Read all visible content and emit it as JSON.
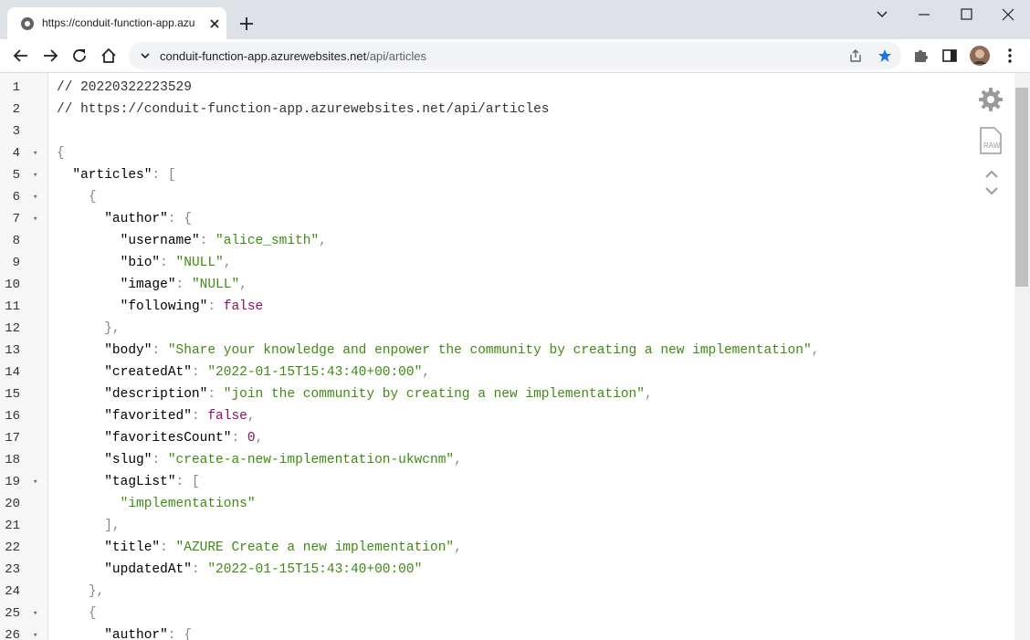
{
  "browser": {
    "tab_title": "https://conduit-function-app.azu",
    "url_host": "conduit-function-app.azurewebsites.net",
    "url_path": "/api/articles",
    "accent": "#1a73e8"
  },
  "editor": {
    "lines": [
      {
        "n": "1",
        "fold": false,
        "html": "<span class=\"c\">// 20220322223529</span>"
      },
      {
        "n": "2",
        "fold": false,
        "html": "<span class=\"c\">// https://conduit-function-app.azurewebsites.net/api/articles</span>"
      },
      {
        "n": "3",
        "fold": false,
        "html": ""
      },
      {
        "n": "4",
        "fold": true,
        "html": "<span class=\"p\">{</span>"
      },
      {
        "n": "5",
        "fold": true,
        "html": "  <span class=\"k\">\"articles\"</span><span class=\"p\">: [</span>"
      },
      {
        "n": "6",
        "fold": true,
        "html": "    <span class=\"p\">{</span>"
      },
      {
        "n": "7",
        "fold": true,
        "html": "      <span class=\"k\">\"author\"</span><span class=\"p\">: {</span>"
      },
      {
        "n": "8",
        "fold": false,
        "html": "        <span class=\"k\">\"username\"</span><span class=\"p\">: </span><span class=\"s\">\"alice_smith\"</span><span class=\"p\">,</span>"
      },
      {
        "n": "9",
        "fold": false,
        "html": "        <span class=\"k\">\"bio\"</span><span class=\"p\">: </span><span class=\"s\">\"NULL\"</span><span class=\"p\">,</span>"
      },
      {
        "n": "10",
        "fold": false,
        "html": "        <span class=\"k\">\"image\"</span><span class=\"p\">: </span><span class=\"s\">\"NULL\"</span><span class=\"p\">,</span>"
      },
      {
        "n": "11",
        "fold": false,
        "html": "        <span class=\"k\">\"following\"</span><span class=\"p\">: </span><span class=\"b\">false</span>"
      },
      {
        "n": "12",
        "fold": false,
        "html": "      <span class=\"p\">},</span>"
      },
      {
        "n": "13",
        "fold": false,
        "html": "      <span class=\"k\">\"body\"</span><span class=\"p\">: </span><span class=\"s\">\"Share your knowledge and enpower the community by creating a new implementation\"</span><span class=\"p\">,</span>"
      },
      {
        "n": "14",
        "fold": false,
        "html": "      <span class=\"k\">\"createdAt\"</span><span class=\"p\">: </span><span class=\"s\">\"2022-01-15T15:43:40+00:00\"</span><span class=\"p\">,</span>"
      },
      {
        "n": "15",
        "fold": false,
        "html": "      <span class=\"k\">\"description\"</span><span class=\"p\">: </span><span class=\"s\">\"join the community by creating a new implementation\"</span><span class=\"p\">,</span>"
      },
      {
        "n": "16",
        "fold": false,
        "html": "      <span class=\"k\">\"favorited\"</span><span class=\"p\">: </span><span class=\"b\">false</span><span class=\"p\">,</span>"
      },
      {
        "n": "17",
        "fold": false,
        "html": "      <span class=\"k\">\"favoritesCount\"</span><span class=\"p\">: </span><span class=\"n\">0</span><span class=\"p\">,</span>"
      },
      {
        "n": "18",
        "fold": false,
        "html": "      <span class=\"k\">\"slug\"</span><span class=\"p\">: </span><span class=\"s\">\"create-a-new-implementation-ukwcnm\"</span><span class=\"p\">,</span>"
      },
      {
        "n": "19",
        "fold": true,
        "html": "      <span class=\"k\">\"tagList\"</span><span class=\"p\">: [</span>"
      },
      {
        "n": "20",
        "fold": false,
        "html": "        <span class=\"s\">\"implementations\"</span>"
      },
      {
        "n": "21",
        "fold": false,
        "html": "      <span class=\"p\">],</span>"
      },
      {
        "n": "22",
        "fold": false,
        "html": "      <span class=\"k\">\"title\"</span><span class=\"p\">: </span><span class=\"s\">\"AZURE Create a new implementation\"</span><span class=\"p\">,</span>"
      },
      {
        "n": "23",
        "fold": false,
        "html": "      <span class=\"k\">\"updatedAt\"</span><span class=\"p\">: </span><span class=\"s\">\"2022-01-15T15:43:40+00:00\"</span>"
      },
      {
        "n": "24",
        "fold": false,
        "html": "    <span class=\"p\">},</span>"
      },
      {
        "n": "25",
        "fold": true,
        "html": "    <span class=\"p\">{</span>"
      },
      {
        "n": "26",
        "fold": true,
        "html": "      <span class=\"k\">\"author\"</span><span class=\"p\">: {</span>"
      }
    ]
  }
}
